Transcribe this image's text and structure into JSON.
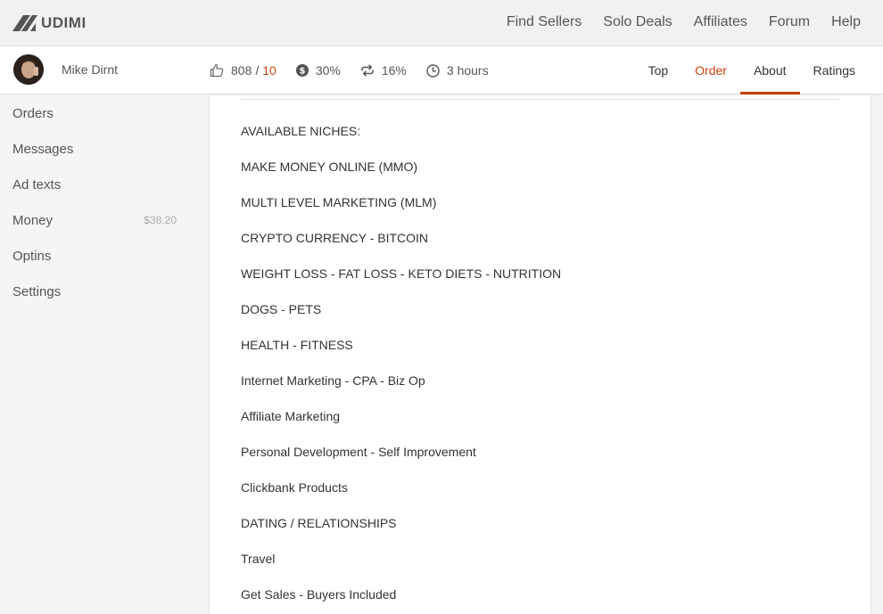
{
  "brand": {
    "name": "UDIMI"
  },
  "topnav": {
    "links": [
      "Find Sellers",
      "Solo Deals",
      "Affiliates",
      "Forum",
      "Help"
    ]
  },
  "profile": {
    "name": "Mike Dirnt",
    "likes": "808",
    "separator": "/",
    "dislikes": "10",
    "sales_percent": "30%",
    "repeat_percent": "16%",
    "response_time": "3 hours"
  },
  "tabs": [
    {
      "label": "Top"
    },
    {
      "label": "Order"
    },
    {
      "label": "About"
    },
    {
      "label": "Ratings"
    }
  ],
  "active_tab": "About",
  "accent_color": "#c8410f",
  "sidebar": {
    "items": [
      {
        "label": "Orders"
      },
      {
        "label": "Messages"
      },
      {
        "label": "Ad texts"
      },
      {
        "label": "Money",
        "amount": "$38.20"
      },
      {
        "label": "Optins"
      },
      {
        "label": "Settings"
      }
    ]
  },
  "about": {
    "lines": [
      "AVAILABLE NICHES:",
      "MAKE MONEY ONLINE (MMO)",
      "MULTI LEVEL MARKETING (MLM)",
      "CRYPTO CURRENCY - BITCOIN",
      "WEIGHT LOSS - FAT LOSS - KETO DIETS - NUTRITION",
      "DOGS - PETS",
      "HEALTH - FITNESS",
      "Internet Marketing - CPA - Biz Op",
      "Affiliate Marketing",
      "Personal Development - Self Improvement",
      "Clickbank Products",
      "DATING / RELATIONSHIPS",
      "Travel",
      "Get Sales - Buyers Included"
    ]
  }
}
